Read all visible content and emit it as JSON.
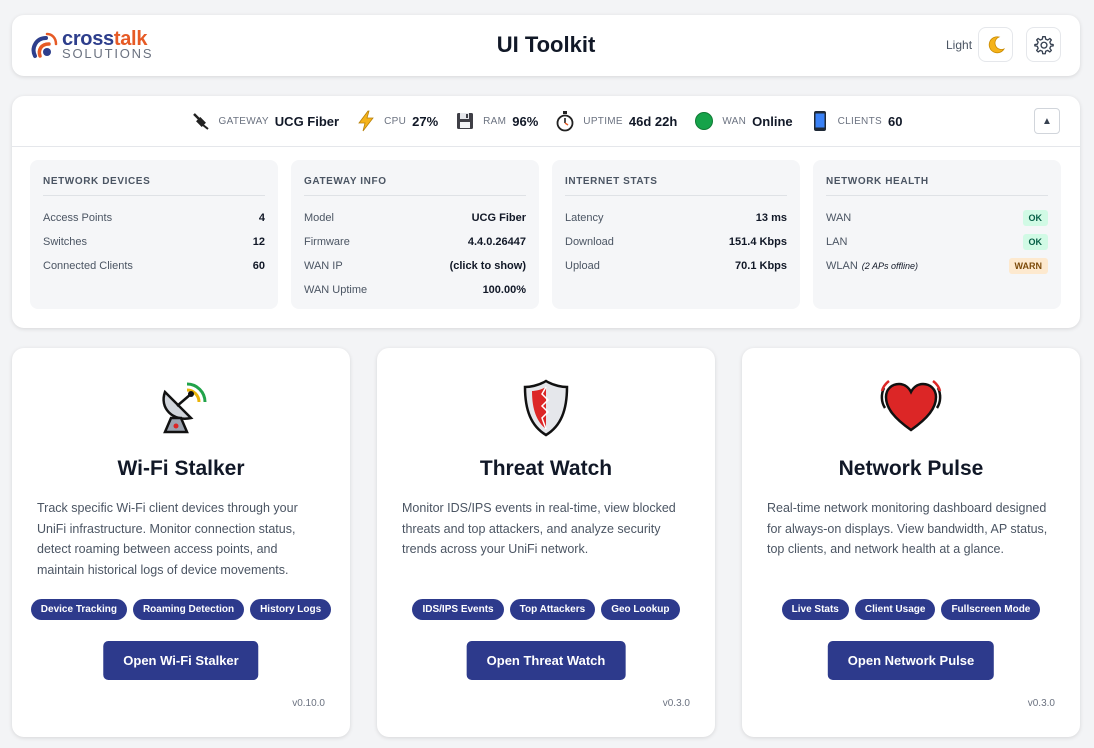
{
  "header": {
    "logo_top_a": "cross",
    "logo_top_b": "talk",
    "logo_bottom": "SOLUTIONS",
    "title": "UI Toolkit",
    "theme_label": "Light",
    "moon_icon": "moon-icon",
    "settings_icon": "gear-icon"
  },
  "status_bar": {
    "gateway": {
      "label": "GATEWAY",
      "value": "UCG Fiber",
      "icon": "ethernet-plug-icon"
    },
    "cpu": {
      "label": "CPU",
      "value": "27%",
      "icon": "lightning-icon"
    },
    "ram": {
      "label": "RAM",
      "value": "96%",
      "icon": "floppy-disk-icon"
    },
    "uptime": {
      "label": "UPTIME",
      "value": "46d 22h",
      "icon": "stopwatch-icon"
    },
    "wan": {
      "label": "WAN",
      "value": "Online",
      "icon": "green-circle-icon"
    },
    "clients": {
      "label": "CLIENTS",
      "value": "60",
      "icon": "mobile-phone-icon"
    },
    "collapse_label": "▲"
  },
  "cards": {
    "devices": {
      "title": "NETWORK DEVICES",
      "rows": [
        {
          "k": "Access Points",
          "v": "4"
        },
        {
          "k": "Switches",
          "v": "12"
        },
        {
          "k": "Connected Clients",
          "v": "60"
        }
      ]
    },
    "gateway": {
      "title": "GATEWAY INFO",
      "rows": [
        {
          "k": "Model",
          "v": "UCG Fiber"
        },
        {
          "k": "Firmware",
          "v": "4.4.0.26447"
        },
        {
          "k": "WAN IP",
          "v": "(click to show)"
        },
        {
          "k": "WAN Uptime",
          "v": "100.00%"
        }
      ]
    },
    "internet": {
      "title": "INTERNET STATS",
      "rows": [
        {
          "k": "Latency",
          "v": "13 ms"
        },
        {
          "k": "Download",
          "v": "151.4 Kbps"
        },
        {
          "k": "Upload",
          "v": "70.1 Kbps"
        }
      ]
    },
    "health": {
      "title": "NETWORK HEALTH",
      "rows": [
        {
          "k": "WAN",
          "note": "",
          "v": "OK"
        },
        {
          "k": "LAN",
          "note": "",
          "v": "OK"
        },
        {
          "k": "WLAN",
          "note": "(2 APs offline)",
          "v": "WARN"
        }
      ]
    }
  },
  "apps": [
    {
      "icon": "satellite-dish-icon",
      "title": "Wi-Fi Stalker",
      "description": "Track specific Wi-Fi client devices through your UniFi infrastructure. Monitor connection status, detect roaming between access points, and maintain historical logs of device movements.",
      "tags": [
        "Device Tracking",
        "Roaming Detection",
        "History Logs"
      ],
      "button": "Open Wi-Fi Stalker",
      "version": "v0.10.0"
    },
    {
      "icon": "shield-icon",
      "title": "Threat Watch",
      "description": "Monitor IDS/IPS events in real-time, view blocked threats and top attackers, and analyze security trends across your UniFi network.",
      "tags": [
        "IDS/IPS Events",
        "Top Attackers",
        "Geo Lookup"
      ],
      "button": "Open Threat Watch",
      "version": "v0.3.0"
    },
    {
      "icon": "beating-heart-icon",
      "title": "Network Pulse",
      "description": "Real-time network monitoring dashboard designed for always-on displays. View bandwidth, AP status, top clients, and network health at a glance.",
      "tags": [
        "Live Stats",
        "Client Usage",
        "Fullscreen Mode"
      ],
      "button": "Open Network Pulse",
      "version": "v0.3.0"
    }
  ],
  "colors": {
    "brand_navy": "#2d3a8c",
    "brand_orange": "#e65a25",
    "ok_bg": "#d1fae5",
    "warn_bg": "#fde9cf"
  }
}
